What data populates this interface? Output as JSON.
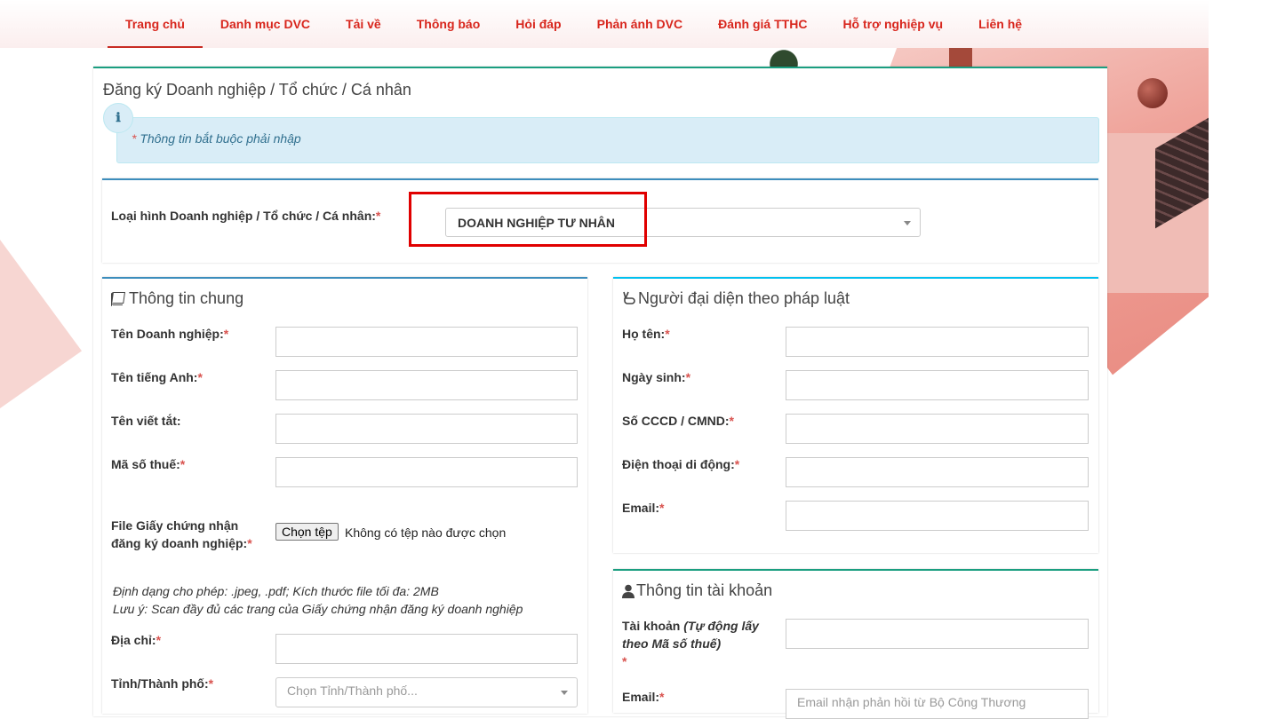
{
  "nav": {
    "items": [
      "Trang chủ",
      "Danh mục DVC",
      "Tải về",
      "Thông báo",
      "Hỏi đáp",
      "Phản ánh DVC",
      "Đánh giá TTHC",
      "Hỗ trợ nghiệp vụ",
      "Liên hệ"
    ],
    "active_index": 0
  },
  "page": {
    "title": "Đăng ký Doanh nghiệp / Tổ chức / Cá nhân",
    "info_icon": "ℹ",
    "required_note": "Thông tin bắt buộc phải nhập",
    "required_star": "*"
  },
  "type": {
    "label": "Loại hình Doanh nghiệp / Tổ chức / Cá nhân:",
    "selected": "DOANH NGHIỆP TƯ NHÂN"
  },
  "general": {
    "title": "Thông tin chung",
    "icon": "book-icon",
    "business_name": "Tên Doanh nghiệp:",
    "english_name": "Tên tiếng Anh:",
    "short_name": "Tên viết tắt:",
    "tax_code": "Mã số thuế:",
    "file_label": "File Giấy chứng nhận đăng ký doanh nghiệp:",
    "file_button": "Chọn tệp",
    "file_status": "Không có tệp nào được chọn",
    "file_note_1": "Định dạng cho phép: .jpeg, .pdf; Kích thước file tối đa: 2MB",
    "file_note_2": "Lưu ý: Scan đầy đủ các trang của Giấy chứng nhận đăng ký doanh nghiệp",
    "address": "Địa chỉ:",
    "province": "Tỉnh/Thành phố:",
    "province_placeholder": "Chọn Tỉnh/Thành phố..."
  },
  "legal_rep": {
    "title": "Người đại diện theo pháp luật",
    "icon": "hand-peace-icon",
    "full_name": "Họ tên:",
    "dob": "Ngày sinh:",
    "id_number": "Số CCCD / CMND:",
    "mobile": "Điện thoại di động:",
    "email": "Email:"
  },
  "account": {
    "title": "Thông tin tài khoản",
    "icon": "user-icon",
    "username": "Tài khoản",
    "username_hint": "(Tự động lấy theo Mã số thuế)",
    "email": "Email:",
    "email_placeholder": "Email nhận phản hồi từ Bộ Công Thương"
  },
  "colors": {
    "nav_text": "#d8261d",
    "accent_green": "#1a9e80",
    "accent_blue": "#3c8dbc",
    "alert_bg": "#d9edf7",
    "highlight": "#e00000"
  }
}
